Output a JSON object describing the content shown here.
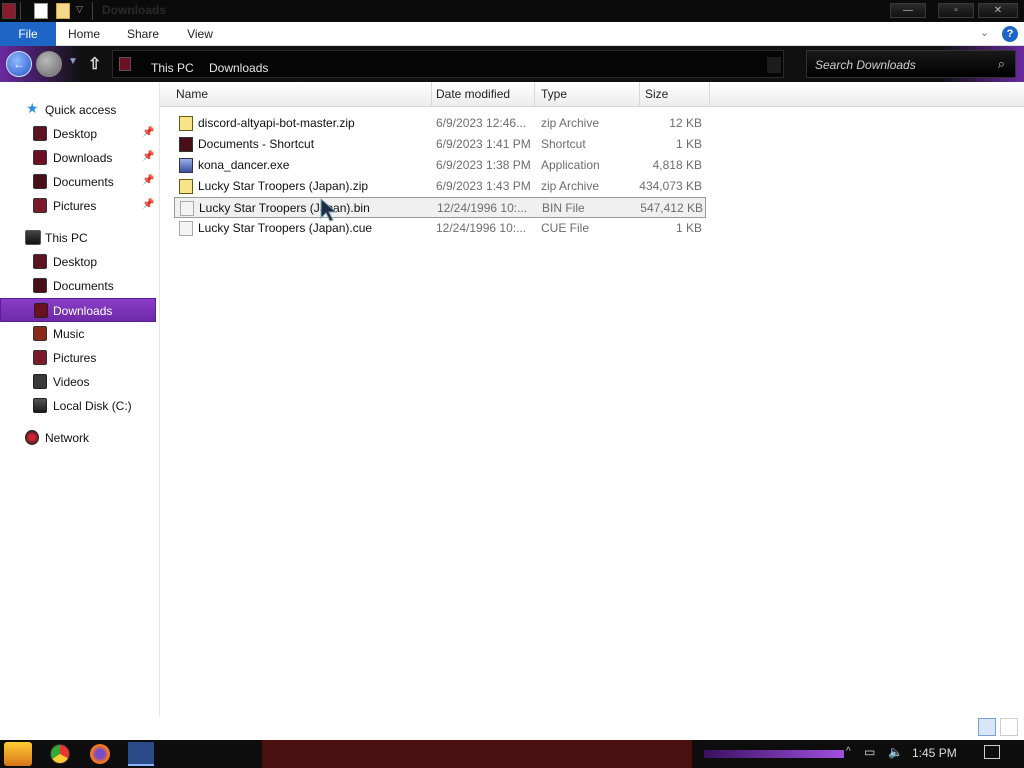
{
  "window": {
    "title": "Downloads"
  },
  "ribbon": {
    "tabs": [
      "File",
      "Home",
      "Share",
      "View"
    ]
  },
  "address": {
    "crumbs": [
      "This PC",
      "Downloads"
    ],
    "search_placeholder": "Search Downloads"
  },
  "nav": {
    "quick_access": "Quick access",
    "quick_items": [
      "Desktop",
      "Downloads",
      "Documents",
      "Pictures"
    ],
    "this_pc": "This PC",
    "pc_items": [
      "Desktop",
      "Documents",
      "Downloads",
      "Music",
      "Pictures",
      "Videos",
      "Local Disk (C:)"
    ],
    "network": "Network"
  },
  "columns": [
    "Name",
    "Date modified",
    "Type",
    "Size"
  ],
  "files": [
    {
      "name": "discord-altyapi-bot-master.zip",
      "date": "6/9/2023 12:46...",
      "type": "zip Archive",
      "size": "12 KB",
      "icon": "zip-icon"
    },
    {
      "name": "Documents - Shortcut",
      "date": "6/9/2023 1:41 PM",
      "type": "Shortcut",
      "size": "1 KB",
      "icon": "shortcut-icon"
    },
    {
      "name": "kona_dancer.exe",
      "date": "6/9/2023 1:38 PM",
      "type": "Application",
      "size": "4,818 KB",
      "icon": "app-icon"
    },
    {
      "name": "Lucky Star Troopers (Japan).zip",
      "date": "6/9/2023 1:43 PM",
      "type": "zip Archive",
      "size": "434,073 KB",
      "icon": "zip-icon"
    },
    {
      "name": "Lucky Star Troopers (Japan).bin",
      "date": "12/24/1996 10:...",
      "type": "BIN File",
      "size": "547,412 KB",
      "icon": "file-icon"
    },
    {
      "name": "Lucky Star Troopers (Japan).cue",
      "date": "12/24/1996 10:...",
      "type": "CUE File",
      "size": "1 KB",
      "icon": "file-icon"
    }
  ],
  "taskbar": {
    "time": "1:45 PM"
  },
  "colors": {
    "accent_purple": "#7a33b8",
    "file_tab": "#1e66c6"
  }
}
